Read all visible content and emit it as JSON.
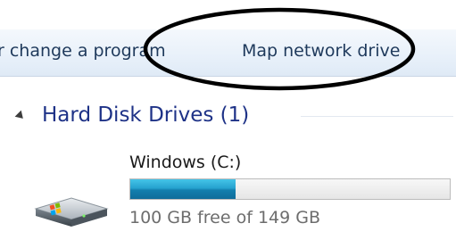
{
  "toolbar": {
    "change_program_label": "r change a program",
    "map_network_drive_label": "Map network drive"
  },
  "hard_disk_group": {
    "title": "Hard Disk Drives (1)",
    "expanded": true,
    "drives": [
      {
        "name": "Windows (C:)",
        "free_text": "100 GB free of 149 GB",
        "used_fraction": 0.33,
        "icon": "hard-drive-icon",
        "bar_color": "#26a2cf"
      }
    ]
  },
  "annotation": {
    "shape": "ellipse",
    "color": "#000000"
  },
  "colors": {
    "toolbar_text": "#1e395b",
    "group_title": "#1e3287",
    "free_text": "#6d6d6d"
  }
}
